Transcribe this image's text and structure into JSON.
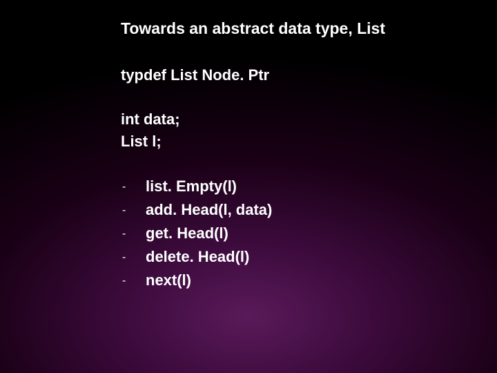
{
  "title": "Towards an abstract data type, List",
  "typedef": "typdef List Node. Ptr",
  "decl": {
    "line1": "int data;",
    "line2": "List l;"
  },
  "bullets": [
    "list. Empty(l)",
    "add. Head(l, data)",
    "get. Head(l)",
    "delete. Head(l)",
    "next(l)"
  ],
  "dash": "-"
}
